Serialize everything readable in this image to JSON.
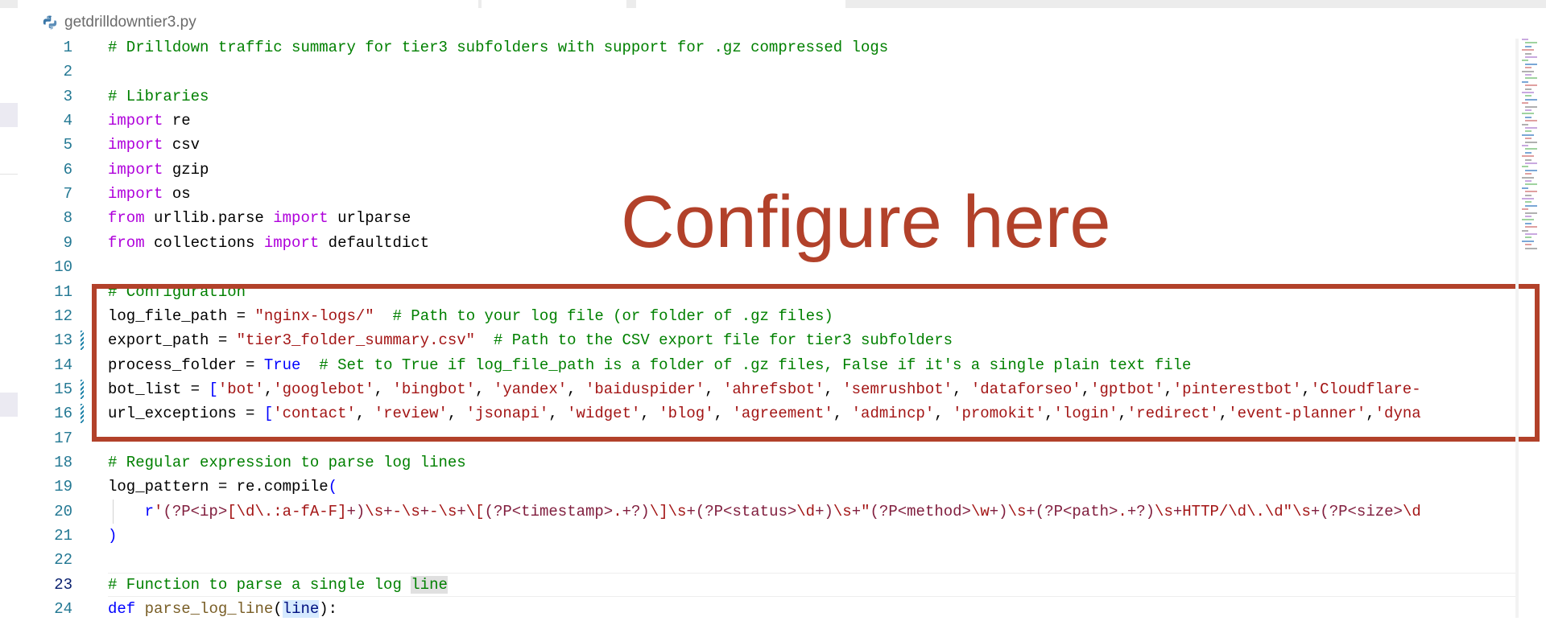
{
  "file": {
    "name": "getdrilldowntier3.py",
    "icon": "python-icon"
  },
  "annotation": {
    "text": "Configure here",
    "color": "#b2412a"
  },
  "lines": [
    {
      "n": "1",
      "tokens": [
        [
          "com",
          "# Drilldown traffic summary for tier3 subfolders with support for .gz compressed logs"
        ]
      ]
    },
    {
      "n": "2",
      "tokens": []
    },
    {
      "n": "3",
      "tokens": [
        [
          "com",
          "# Libraries"
        ]
      ]
    },
    {
      "n": "4",
      "tokens": [
        [
          "kw",
          "import"
        ],
        [
          "",
          " re"
        ]
      ]
    },
    {
      "n": "5",
      "tokens": [
        [
          "kw",
          "import"
        ],
        [
          "",
          " csv"
        ]
      ]
    },
    {
      "n": "6",
      "tokens": [
        [
          "kw",
          "import"
        ],
        [
          "",
          " gzip"
        ]
      ]
    },
    {
      "n": "7",
      "tokens": [
        [
          "kw",
          "import"
        ],
        [
          "",
          " os"
        ]
      ]
    },
    {
      "n": "8",
      "tokens": [
        [
          "kw",
          "from"
        ],
        [
          "",
          " urllib.parse "
        ],
        [
          "kw",
          "import"
        ],
        [
          "",
          " urlparse"
        ]
      ]
    },
    {
      "n": "9",
      "tokens": [
        [
          "kw",
          "from"
        ],
        [
          "",
          " collections "
        ],
        [
          "kw",
          "import"
        ],
        [
          "",
          " defaultdict"
        ]
      ]
    },
    {
      "n": "10",
      "tokens": []
    },
    {
      "n": "11",
      "tokens": [
        [
          "com",
          "# Configuration"
        ]
      ]
    },
    {
      "n": "12",
      "tokens": [
        [
          "",
          "log_file_path = "
        ],
        [
          "str",
          "\"nginx-logs/\""
        ],
        [
          "",
          "  "
        ],
        [
          "com",
          "# Path to your log file (or folder of .gz files)"
        ]
      ]
    },
    {
      "n": "13",
      "mod": true,
      "tokens": [
        [
          "",
          "export_path = "
        ],
        [
          "str",
          "\"tier3_folder_summary.csv\""
        ],
        [
          "",
          "  "
        ],
        [
          "com",
          "# Path to the CSV export file for tier3 subfolders"
        ]
      ]
    },
    {
      "n": "14",
      "tokens": [
        [
          "",
          "process_folder = "
        ],
        [
          "kwb",
          "True"
        ],
        [
          "",
          "  "
        ],
        [
          "com",
          "# Set to True if log_file_path is a folder of .gz files, False if it's a single plain text file"
        ]
      ]
    },
    {
      "n": "15",
      "mod": true,
      "tokens": [
        [
          "",
          "bot_list = "
        ],
        [
          "kwb",
          "["
        ],
        [
          "str",
          "'bot'"
        ],
        [
          "",
          ","
        ],
        [
          "str",
          "'googlebot'"
        ],
        [
          "",
          ", "
        ],
        [
          "str",
          "'bingbot'"
        ],
        [
          "",
          ", "
        ],
        [
          "str",
          "'yandex'"
        ],
        [
          "",
          ", "
        ],
        [
          "str",
          "'baiduspider'"
        ],
        [
          "",
          ", "
        ],
        [
          "str",
          "'ahrefsbot'"
        ],
        [
          "",
          ", "
        ],
        [
          "str",
          "'semrushbot'"
        ],
        [
          "",
          ", "
        ],
        [
          "str",
          "'dataforseo'"
        ],
        [
          "",
          ","
        ],
        [
          "str",
          "'gptbot'"
        ],
        [
          "",
          ","
        ],
        [
          "str",
          "'pinterestbot'"
        ],
        [
          "",
          ","
        ],
        [
          "str",
          "'Cloudflare-"
        ]
      ]
    },
    {
      "n": "16",
      "mod": true,
      "tokens": [
        [
          "",
          "url_exceptions = "
        ],
        [
          "kwb",
          "["
        ],
        [
          "str",
          "'contact'"
        ],
        [
          "",
          ", "
        ],
        [
          "str",
          "'review'"
        ],
        [
          "",
          ", "
        ],
        [
          "str",
          "'jsonapi'"
        ],
        [
          "",
          ", "
        ],
        [
          "str",
          "'widget'"
        ],
        [
          "",
          ", "
        ],
        [
          "str",
          "'blog'"
        ],
        [
          "",
          ", "
        ],
        [
          "str",
          "'agreement'"
        ],
        [
          "",
          ", "
        ],
        [
          "str",
          "'admincp'"
        ],
        [
          "",
          ", "
        ],
        [
          "str",
          "'promokit'"
        ],
        [
          "",
          ","
        ],
        [
          "str",
          "'login'"
        ],
        [
          "",
          ","
        ],
        [
          "str",
          "'redirect'"
        ],
        [
          "",
          ","
        ],
        [
          "str",
          "'event-planner'"
        ],
        [
          "",
          ","
        ],
        [
          "str",
          "'dyna"
        ]
      ]
    },
    {
      "n": "17",
      "tokens": []
    },
    {
      "n": "18",
      "tokens": [
        [
          "com",
          "# Regular expression to parse log lines"
        ]
      ]
    },
    {
      "n": "19",
      "tokens": [
        [
          "",
          "log_pattern = re.compile"
        ],
        [
          "kwb",
          "("
        ]
      ]
    },
    {
      "n": "20",
      "indent": true,
      "tokens": [
        [
          "",
          "    "
        ],
        [
          "kwb",
          "r"
        ],
        [
          "str",
          "'"
        ],
        [
          "reg",
          "(?P<ip>"
        ],
        [
          "str",
          "[\\d\\.:a-fA-F]"
        ],
        [
          "reg",
          "+)"
        ],
        [
          "str",
          "\\s"
        ],
        [
          "reg",
          "+"
        ],
        [
          "str",
          "-\\s"
        ],
        [
          "reg",
          "+"
        ],
        [
          "str",
          "-\\s"
        ],
        [
          "reg",
          "+"
        ],
        [
          "str",
          "\\["
        ],
        [
          "reg",
          "(?P<timestamp>"
        ],
        [
          "str",
          "."
        ],
        [
          "reg",
          "+?)"
        ],
        [
          "str",
          "\\]\\s"
        ],
        [
          "reg",
          "+(?P<status>"
        ],
        [
          "str",
          "\\d"
        ],
        [
          "reg",
          "+)"
        ],
        [
          "str",
          "\\s"
        ],
        [
          "reg",
          "+"
        ],
        [
          "str",
          "\""
        ],
        [
          "reg",
          "(?P<method>"
        ],
        [
          "str",
          "\\w"
        ],
        [
          "reg",
          "+)"
        ],
        [
          "str",
          "\\s"
        ],
        [
          "reg",
          "+(?P<path>"
        ],
        [
          "str",
          "."
        ],
        [
          "reg",
          "+?)"
        ],
        [
          "str",
          "\\s"
        ],
        [
          "reg",
          "+"
        ],
        [
          "str",
          "HTTP/\\d\\.\\d\"\\s"
        ],
        [
          "reg",
          "+(?P<size>"
        ],
        [
          "str",
          "\\d"
        ]
      ]
    },
    {
      "n": "21",
      "tokens": [
        [
          "kwb",
          ")"
        ]
      ]
    },
    {
      "n": "22",
      "tokens": []
    },
    {
      "n": "23",
      "active": true,
      "tokens": [
        [
          "com",
          "# Function to parse a single log "
        ],
        [
          "comhl",
          "line"
        ]
      ]
    },
    {
      "n": "24",
      "tokens": [
        [
          "kwb",
          "def"
        ],
        [
          "",
          " "
        ],
        [
          "fn",
          "parse_log_line"
        ],
        [
          "",
          "("
        ],
        [
          "dimhl",
          "line"
        ],
        [
          "",
          "):"
        ]
      ]
    }
  ]
}
